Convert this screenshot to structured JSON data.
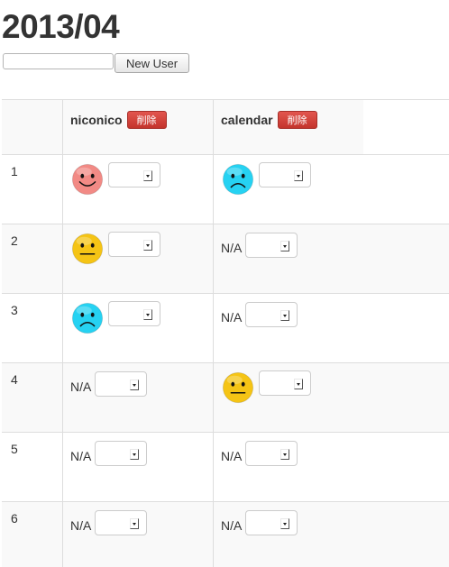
{
  "title": "2013/04",
  "new_user": {
    "input_value": "",
    "button_label": "New User"
  },
  "columns": [
    {
      "name": "niconico",
      "delete_label": "削除"
    },
    {
      "name": "calendar",
      "delete_label": "削除"
    }
  ],
  "na_label": "N/A",
  "rows": [
    {
      "number": "1",
      "cells": [
        {
          "mood": "happy",
          "color": "#f28a85"
        },
        {
          "mood": "sad",
          "color": "#26d2f2"
        }
      ]
    },
    {
      "number": "2",
      "cells": [
        {
          "mood": "neutral",
          "color": "#f5c415"
        },
        {
          "mood": "na"
        }
      ]
    },
    {
      "number": "3",
      "cells": [
        {
          "mood": "sad",
          "color": "#26d2f2"
        },
        {
          "mood": "na"
        }
      ]
    },
    {
      "number": "4",
      "cells": [
        {
          "mood": "na"
        },
        {
          "mood": "neutral",
          "color": "#f5c415"
        }
      ]
    },
    {
      "number": "5",
      "cells": [
        {
          "mood": "na"
        },
        {
          "mood": "na"
        }
      ]
    },
    {
      "number": "6",
      "cells": [
        {
          "mood": "na"
        },
        {
          "mood": "na"
        }
      ]
    }
  ],
  "colors": {
    "delete_button": "#d9433d",
    "happy_face": "#f28a85",
    "neutral_face": "#f5c415",
    "sad_face": "#26d2f2"
  }
}
